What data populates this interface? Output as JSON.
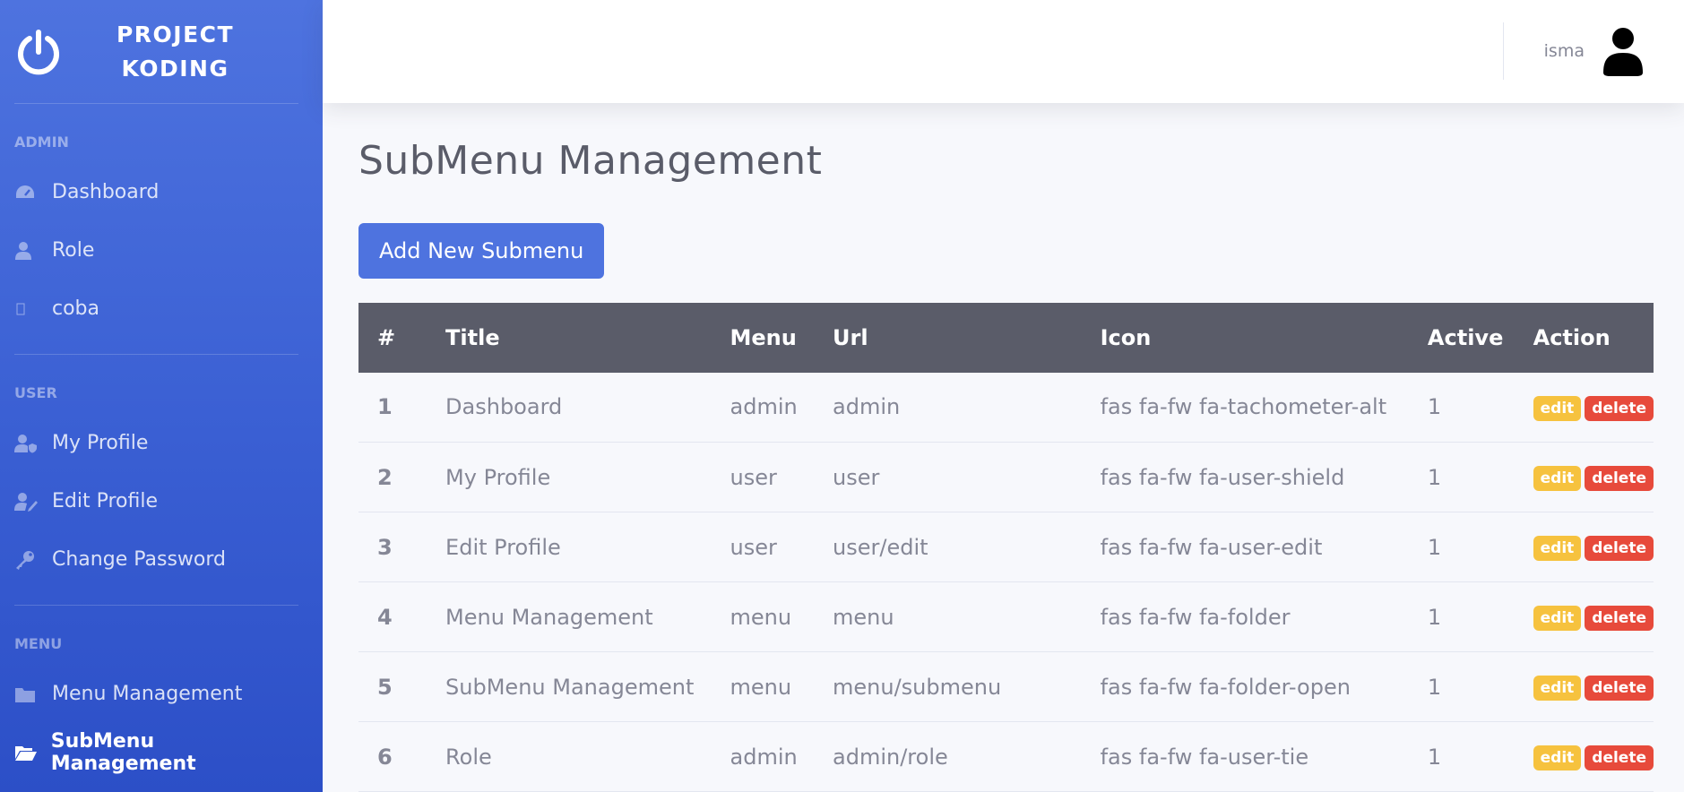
{
  "brand": {
    "line1": "PROJECT",
    "line2": "KODING",
    "logo_icon": "power-icon"
  },
  "sidebar": {
    "sections": [
      {
        "heading": "ADMIN",
        "items": [
          {
            "label": "Dashboard",
            "icon": "tachometer-icon"
          },
          {
            "label": "Role",
            "icon": "user-tie-icon"
          },
          {
            "label": "coba",
            "icon": "missing-glyph-icon"
          }
        ]
      },
      {
        "heading": "USER",
        "items": [
          {
            "label": "My Profile",
            "icon": "user-shield-icon"
          },
          {
            "label": "Edit Profile",
            "icon": "user-edit-icon"
          },
          {
            "label": "Change Password",
            "icon": "key-icon"
          }
        ]
      },
      {
        "heading": "MENU",
        "items": [
          {
            "label": "Menu Management",
            "icon": "folder-icon"
          },
          {
            "label": "SubMenu Management",
            "icon": "folder-open-icon",
            "active": true
          }
        ]
      }
    ]
  },
  "topbar": {
    "user_name": "isma",
    "avatar_icon": "user-avatar-icon"
  },
  "page": {
    "title": "SubMenu Management",
    "add_button": "Add New Submenu"
  },
  "table": {
    "headers": [
      "#",
      "Title",
      "Menu",
      "Url",
      "Icon",
      "Active",
      "Action"
    ],
    "rows": [
      [
        "1",
        "Dashboard",
        "admin",
        "admin",
        "fas fa-fw fa-tachometer-alt",
        "1"
      ],
      [
        "2",
        "My Profile",
        "user",
        "user",
        "fas fa-fw fa-user-shield",
        "1"
      ],
      [
        "3",
        "Edit Profile",
        "user",
        "user/edit",
        "fas fa-fw fa-user-edit",
        "1"
      ],
      [
        "4",
        "Menu Management",
        "menu",
        "menu",
        "fas fa-fw fa-folder",
        "1"
      ],
      [
        "5",
        "SubMenu Management",
        "menu",
        "menu/submenu",
        "fas fa-fw fa-folder-open",
        "1"
      ],
      [
        "6",
        "Role",
        "admin",
        "admin/role",
        "fas fa-fw fa-user-tie",
        "1"
      ]
    ],
    "actions": {
      "edit": "edit",
      "delete": "delete"
    }
  },
  "colors": {
    "primary": "#4e73df",
    "table_header": "#5a5c69",
    "warning": "#f6c23e",
    "danger": "#e74a3b"
  }
}
